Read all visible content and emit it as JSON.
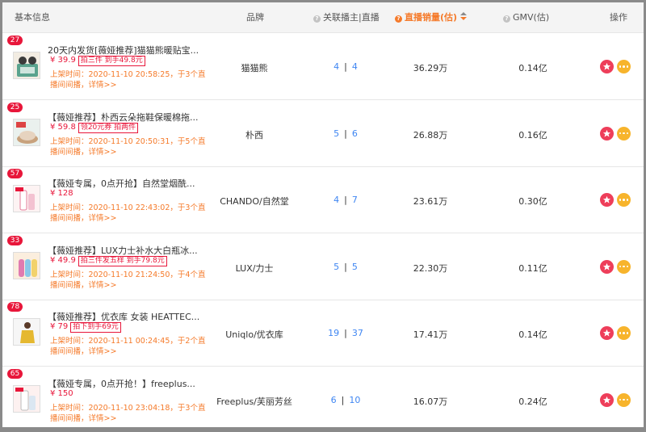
{
  "header": {
    "basic_info": "基本信息",
    "brand": "品牌",
    "related": "关联播主|直播",
    "sales": "直播销量(估)",
    "gmv": "GMV(估)",
    "actions": "操作"
  },
  "colors": {
    "accent": "#f57a2a",
    "rank_badge": "#e8163a",
    "count_link": "#3f86f2",
    "star_button": "#ee3e5a",
    "more_button": "#f7b42c"
  },
  "icons": {
    "info": "info-icon",
    "sort": "sort-caret-icon",
    "star": "star-icon",
    "more": "ellipsis-icon"
  },
  "rows": [
    {
      "rank": "27",
      "name": "20天内发货[薇娅推荐]猫猫熊暖贴宝...",
      "price": "¥ 39.9",
      "promo": "拍三件 到手49.8元",
      "shelf": "上架时间：2020-11-10 20:58:25，于3个直播间间播，",
      "detail": "详情>>",
      "brand": "猫猫熊",
      "hosts": "4",
      "lives": "4",
      "sales": "36.29万",
      "gmv": "0.14亿"
    },
    {
      "rank": "25",
      "name": "【薇娅推荐】朴西云朵拖鞋保暖棉拖...",
      "price": "¥ 59.8",
      "promo": "领20元券 拍两件",
      "shelf": "上架时间：2020-11-10 20:50:31，于5个直播间间播，",
      "detail": "详情>>",
      "brand": "朴西",
      "hosts": "5",
      "lives": "6",
      "sales": "26.88万",
      "gmv": "0.16亿"
    },
    {
      "rank": "57",
      "name": "【薇娅专属，0点开抢】自然堂烟酰...",
      "price": "¥ 128",
      "promo": "",
      "shelf": "上架时间：2020-11-10 22:43:02，于3个直播间间播，",
      "detail": "详情>>",
      "brand": "CHANDO/自然堂",
      "hosts": "4",
      "lives": "7",
      "sales": "23.61万",
      "gmv": "0.30亿"
    },
    {
      "rank": "33",
      "name": "【薇娅推荐】LUX力士补水大白瓶冰...",
      "price": "¥ 49.9",
      "promo": "拍三件发五样 到手79.8元",
      "shelf": "上架时间：2020-11-10 21:24:50，于4个直播间间播，",
      "detail": "详情>>",
      "brand": "LUX/力士",
      "hosts": "5",
      "lives": "5",
      "sales": "22.30万",
      "gmv": "0.11亿"
    },
    {
      "rank": "78",
      "name": "【薇娅推荐】优衣库 女装 HEATTEC...",
      "price": "¥ 79",
      "promo": "拍下到手69元",
      "shelf": "上架时间：2020-11-11 00:24:45，于2个直播间间播，",
      "detail": "详情>>",
      "brand": "Uniqlo/优衣库",
      "hosts": "19",
      "lives": "37",
      "sales": "17.41万",
      "gmv": "0.14亿"
    },
    {
      "rank": "65",
      "name": "【薇娅专属，0点开抢！】freeplus...",
      "price": "¥ 150",
      "promo": "",
      "shelf": "上架时间：2020-11-10 23:04:18，于3个直播间间播，",
      "detail": "详情>>",
      "brand": "Freeplus/芙丽芳丝",
      "hosts": "6",
      "lives": "10",
      "sales": "16.07万",
      "gmv": "0.24亿"
    }
  ]
}
